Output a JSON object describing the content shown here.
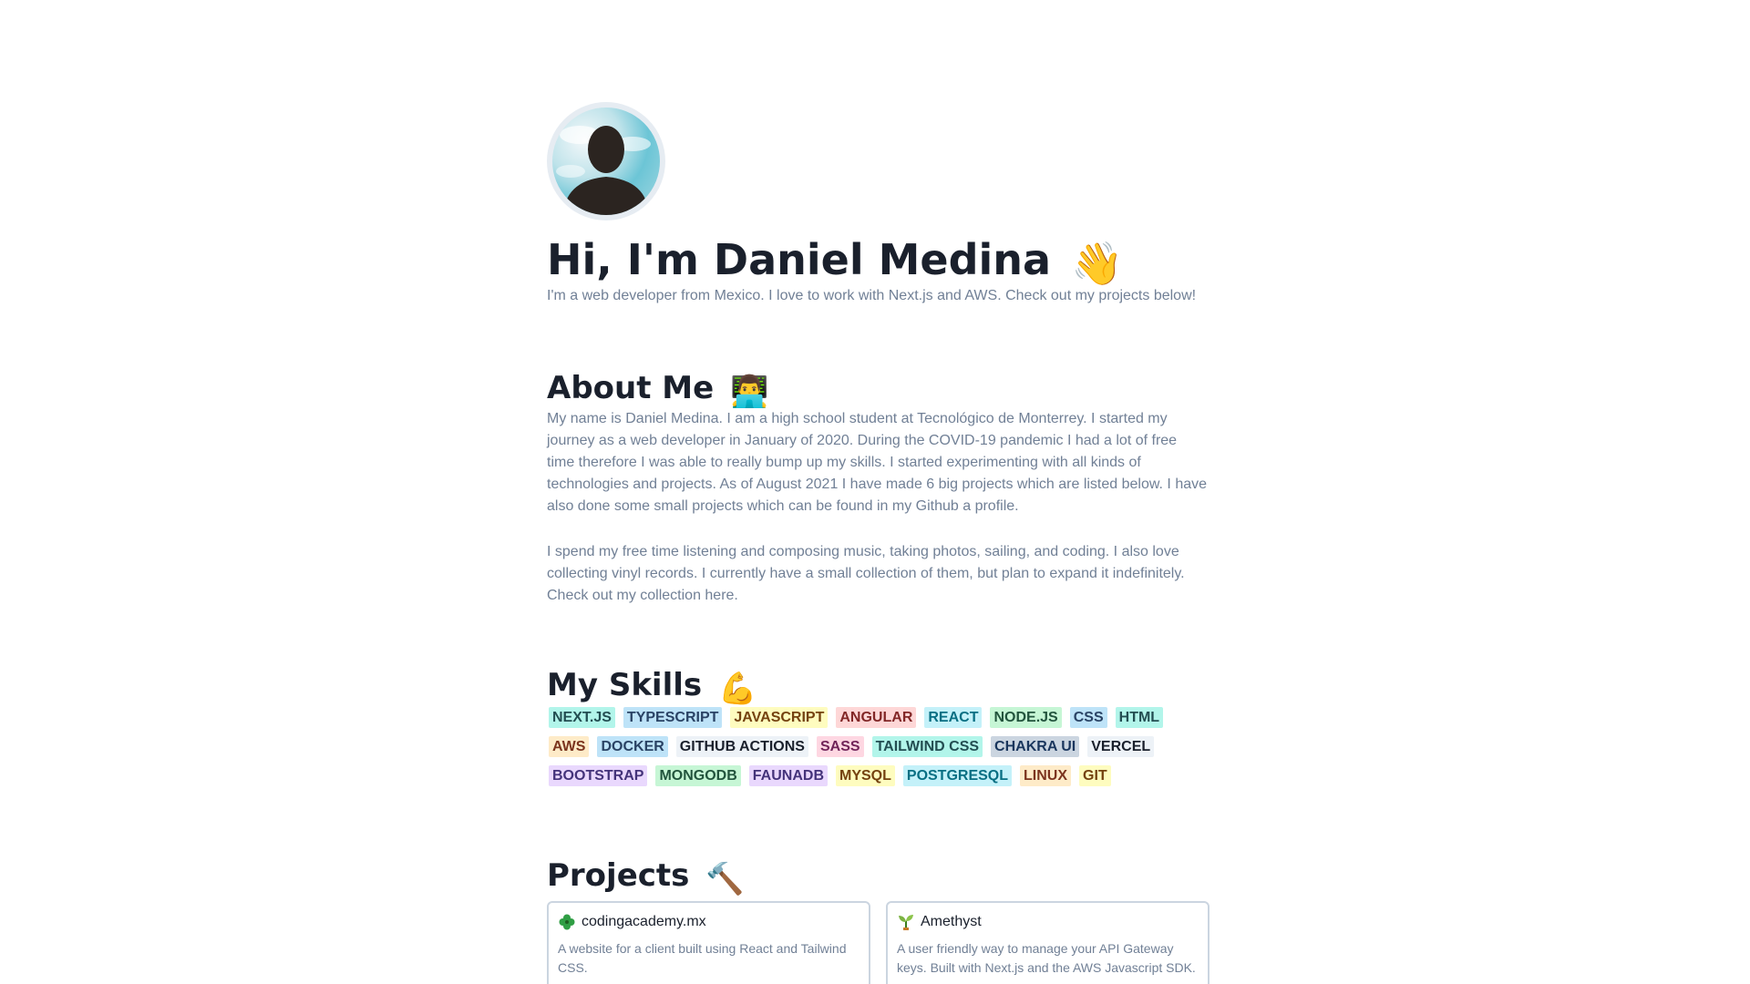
{
  "hero": {
    "title": "Hi, I'm Daniel Medina",
    "title_emoji": "👋",
    "subtitle": "I'm a web developer from Mexico. I love to work with Next.js and AWS. Check out my projects below!"
  },
  "about": {
    "title": "About Me",
    "title_emoji": "👨‍💻",
    "paragraph_1": "My name is Daniel Medina. I am a high school student at Tecnológico de Monterrey. I started my journey as a web developer in January of 2020. During the COVID-19 pandemic I had a lot of free time therefore I was able to really bump up my skills. I started experimenting with all kinds of technologies and projects. As of August 2021 I have made 6 big projects which are listed below. I have also done some small projects which can be found in my Github a profile.",
    "paragraph_2": "I spend my free time listening and composing music, taking photos, sailing, and coding. I also love collecting vinyl records. I currently have a small collection of them, but plan to expand it indefinitely. Check out my collection here."
  },
  "skills": {
    "title": "My Skills",
    "title_emoji": "💪",
    "rows": [
      [
        {
          "label": "NEXT.JS",
          "bg": "#b2f5ea",
          "fg": "#234e52"
        },
        {
          "label": "TYPESCRIPT",
          "bg": "#bee3f8",
          "fg": "#2a4365"
        },
        {
          "label": "JAVASCRIPT",
          "bg": "#fefcbf",
          "fg": "#744210"
        },
        {
          "label": "ANGULAR",
          "bg": "#fed7d7",
          "fg": "#822727"
        },
        {
          "label": "REACT",
          "bg": "#c4f1f9",
          "fg": "#086f83"
        },
        {
          "label": "NODE.JS",
          "bg": "#c6f6d5",
          "fg": "#22543d"
        },
        {
          "label": "CSS",
          "bg": "#bee3f8",
          "fg": "#2a4365"
        },
        {
          "label": "HTML",
          "bg": "#b2f5ea",
          "fg": "#234e52"
        }
      ],
      [
        {
          "label": "AWS",
          "bg": "#feebc8",
          "fg": "#7b341e"
        },
        {
          "label": "DOCKER",
          "bg": "#bee3f8",
          "fg": "#2a4365"
        },
        {
          "label": "GITHUB ACTIONS",
          "bg": "#edf2f7",
          "fg": "#1a202c"
        },
        {
          "label": "SASS",
          "bg": "#fed7e2",
          "fg": "#702459"
        },
        {
          "label": "TAILWIND CSS",
          "bg": "#b2f5ea",
          "fg": "#234e52"
        },
        {
          "label": "CHAKRA UI",
          "bg": "#cbd5e0",
          "fg": "#1a365d"
        },
        {
          "label": "VERCEL",
          "bg": "#edf2f7",
          "fg": "#1a202c"
        }
      ],
      [
        {
          "label": "BOOTSTRAP",
          "bg": "#e9d8fd",
          "fg": "#44337a"
        },
        {
          "label": "MONGODB",
          "bg": "#c6f6d5",
          "fg": "#22543d"
        },
        {
          "label": "FAUNADB",
          "bg": "#e9d8fd",
          "fg": "#44337a"
        },
        {
          "label": "MYSQL",
          "bg": "#fefcbf",
          "fg": "#744210"
        },
        {
          "label": "POSTGRESQL",
          "bg": "#c4f1f9",
          "fg": "#086f83"
        },
        {
          "label": "LINUX",
          "bg": "#feebc8",
          "fg": "#7b341e"
        },
        {
          "label": "GIT",
          "bg": "#fefcbf",
          "fg": "#744210"
        }
      ]
    ]
  },
  "projects": {
    "title": "Projects",
    "title_emoji": "🔨",
    "items": [
      {
        "name": "codingacademy.mx",
        "icon": "clover-icon",
        "description": "A website for a client built using React and Tailwind CSS."
      },
      {
        "name": "Amethyst",
        "icon": "seedling-icon",
        "description": "A user friendly way to manage your API Gateway keys. Built with Next.js and the AWS Javascript SDK."
      }
    ]
  }
}
